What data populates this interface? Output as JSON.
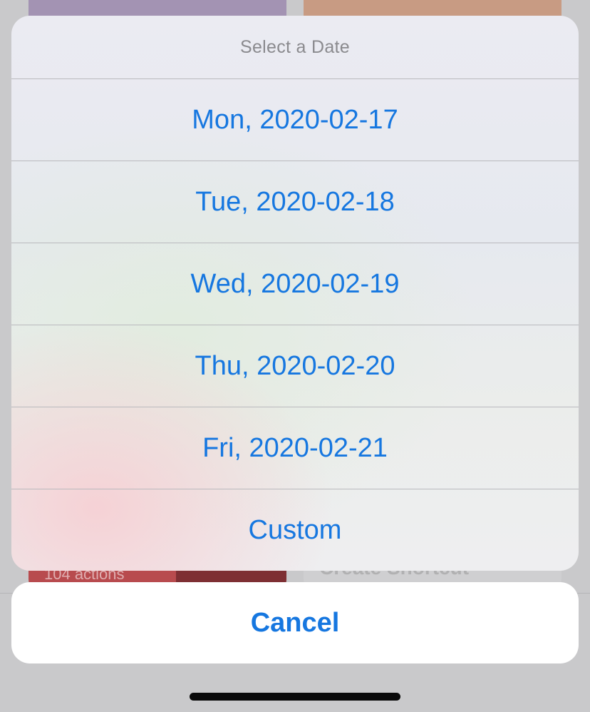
{
  "sheet": {
    "title": "Select a Date",
    "options": [
      {
        "label": "Mon, 2020-02-17"
      },
      {
        "label": "Tue, 2020-02-18"
      },
      {
        "label": "Wed, 2020-02-19"
      },
      {
        "label": "Thu, 2020-02-20"
      },
      {
        "label": "Fri, 2020-02-21"
      },
      {
        "label": "Custom"
      }
    ]
  },
  "cancel_label": "Cancel",
  "background": {
    "red_tile_caption": "104 actions",
    "gray_tile_caption": "Create Shortcut"
  },
  "colors": {
    "accent": "#1677e0",
    "overlay": "#c9c9cb"
  }
}
